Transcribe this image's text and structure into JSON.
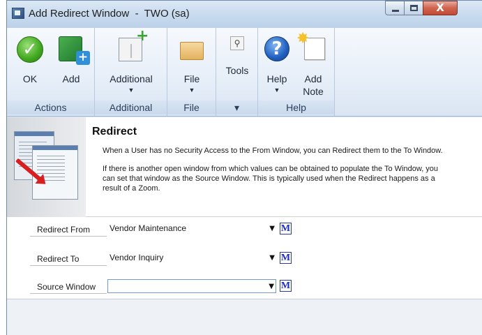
{
  "window": {
    "title": "Add Redirect Window  -  TWO (sa)",
    "controls": {
      "minimize": "–",
      "maximize": "□",
      "close": "X"
    }
  },
  "ribbon": {
    "groups": [
      {
        "label": "Actions",
        "buttons": [
          {
            "label": "OK",
            "icon": "ok-check-icon"
          },
          {
            "label": "Add",
            "icon": "add-icon"
          }
        ]
      },
      {
        "label": "Additional",
        "buttons": [
          {
            "label": "Additional",
            "icon": "additional-icon",
            "dropdown": "▼"
          }
        ]
      },
      {
        "label": "File",
        "buttons": [
          {
            "label": "File",
            "icon": "folder-icon",
            "dropdown": "▼"
          }
        ]
      },
      {
        "label": "▾",
        "buttons": [
          {
            "label": "Tools",
            "icon": "tools-icon"
          }
        ]
      },
      {
        "label": "Help",
        "buttons": [
          {
            "label": "Help",
            "icon": "help-icon",
            "dropdown": "▼"
          },
          {
            "label": "Add\nNote",
            "label_line1": "Add",
            "label_line2": "Note",
            "icon": "note-icon"
          }
        ]
      }
    ]
  },
  "header": {
    "title": "Redirect",
    "line1": "When a User has no Security Access to the From Window, you can Redirect them to the To Window.",
    "line2": "If there is another open window from which values can be obtained to populate the To Window, you",
    "line3": "can set that window as the Source Window.  This is typically used when the Redirect happens as a",
    "line4": "result of a Zoom."
  },
  "form": {
    "redirect_from": {
      "label": "Redirect From",
      "value": "Vendor Maintenance"
    },
    "redirect_to": {
      "label": "Redirect To",
      "value": "Vendor Inquiry"
    },
    "source_window": {
      "label": "Source Window",
      "value": ""
    },
    "dropdown_glyph": "▼",
    "m_button": "M"
  }
}
